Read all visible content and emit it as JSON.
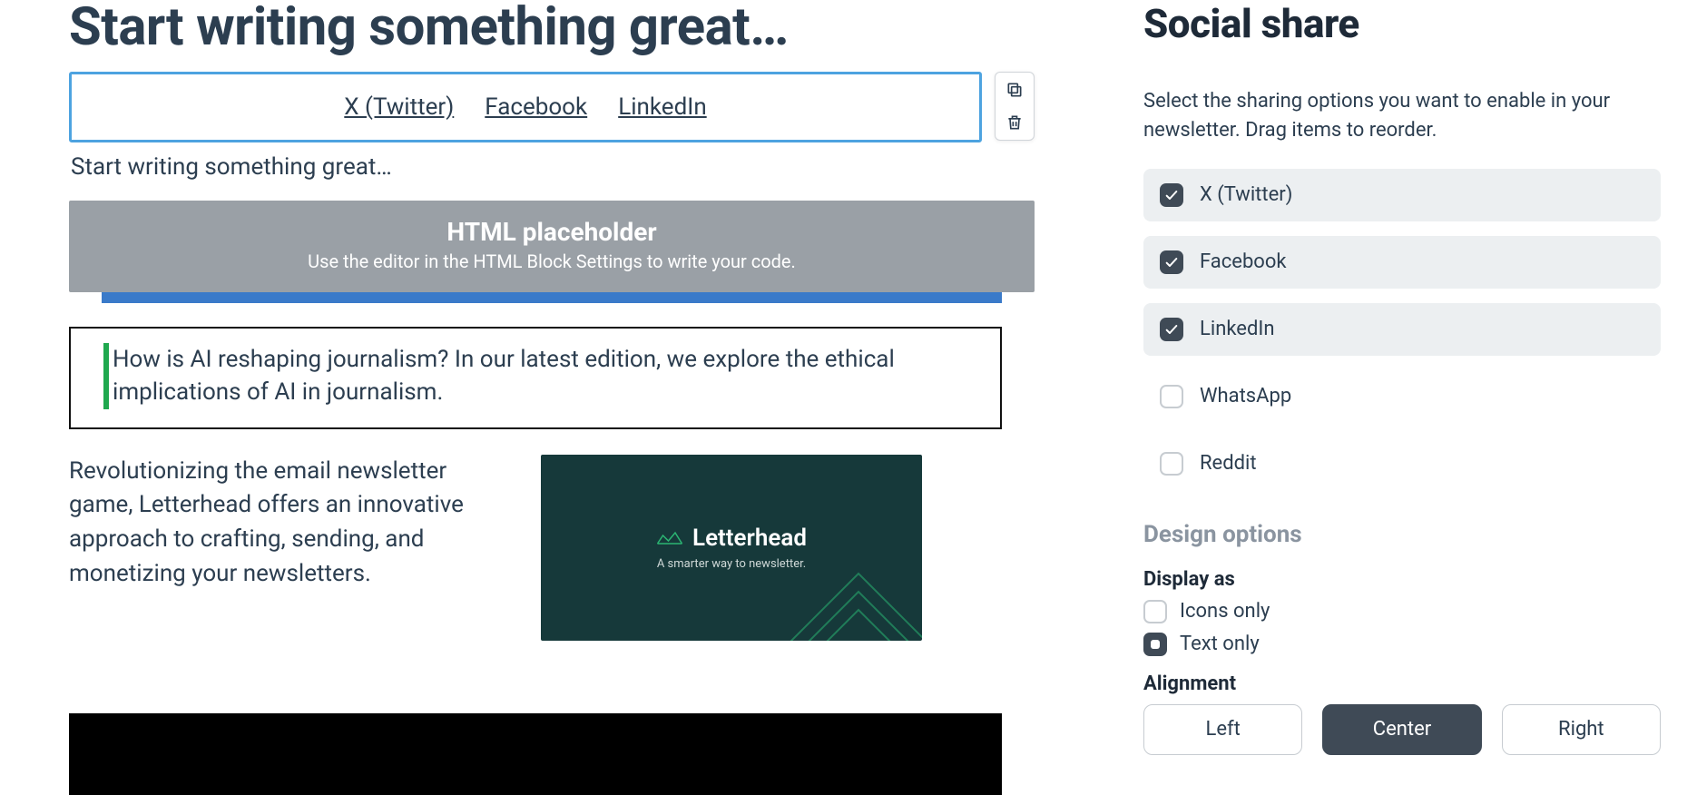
{
  "editor": {
    "title": "Start writing something great…",
    "share_links": [
      "X (Twitter)",
      "Facebook",
      "LinkedIn"
    ],
    "body_line": "Start writing something great…",
    "html_block": {
      "title": "HTML placeholder",
      "sub": "Use the editor in the HTML Block Settings to write your code."
    },
    "quote": "How is AI reshaping journalism? In our latest edition, we explore the ethical implications of AI in journalism.",
    "feature_copy": "Revolutionizing the email newsletter game, Letterhead offers an innovative approach to crafting, sending, and monetizing your newsletters.",
    "feature_brand": "Letterhead",
    "feature_tag": "A smarter way to newsletter."
  },
  "panel": {
    "title": "Social share",
    "description": "Select the sharing options you want to enable in your newsletter. Drag items to reorder.",
    "options": [
      {
        "label": "X (Twitter)",
        "checked": true
      },
      {
        "label": "Facebook",
        "checked": true
      },
      {
        "label": "LinkedIn",
        "checked": true
      },
      {
        "label": "WhatsApp",
        "checked": false
      },
      {
        "label": "Reddit",
        "checked": false
      }
    ],
    "design_heading": "Design options",
    "display_as_label": "Display as",
    "display_as": [
      {
        "label": "Icons only",
        "selected": false
      },
      {
        "label": "Text only",
        "selected": true
      }
    ],
    "alignment_label": "Alignment",
    "alignment": [
      {
        "label": "Left",
        "active": false
      },
      {
        "label": "Center",
        "active": true
      },
      {
        "label": "Right",
        "active": false
      }
    ]
  }
}
